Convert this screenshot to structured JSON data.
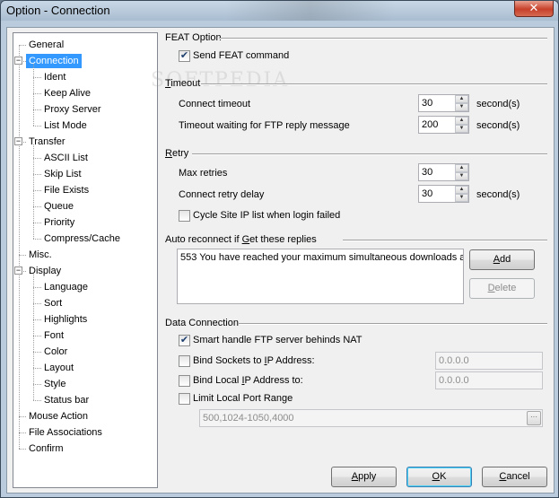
{
  "window": {
    "title": "Option - Connection",
    "close_label": "✕",
    "watermark": "SOFTPEDIA"
  },
  "tree": {
    "items": [
      {
        "label": "General",
        "level": 0
      },
      {
        "label": "Connection",
        "level": 0,
        "selected": true,
        "expander": "−"
      },
      {
        "label": "Ident",
        "level": 1
      },
      {
        "label": "Keep Alive",
        "level": 1
      },
      {
        "label": "Proxy Server",
        "level": 1
      },
      {
        "label": "List Mode",
        "level": 1
      },
      {
        "label": "Transfer",
        "level": 0,
        "expander": "−"
      },
      {
        "label": "ASCII List",
        "level": 1
      },
      {
        "label": "Skip List",
        "level": 1
      },
      {
        "label": "File Exists",
        "level": 1
      },
      {
        "label": "Queue",
        "level": 1
      },
      {
        "label": "Priority",
        "level": 1
      },
      {
        "label": "Compress/Cache",
        "level": 1
      },
      {
        "label": "Misc.",
        "level": 0
      },
      {
        "label": "Display",
        "level": 0,
        "expander": "−"
      },
      {
        "label": "Language",
        "level": 1
      },
      {
        "label": "Sort",
        "level": 1
      },
      {
        "label": "Highlights",
        "level": 1
      },
      {
        "label": "Font",
        "level": 1
      },
      {
        "label": "Color",
        "level": 1
      },
      {
        "label": "Layout",
        "level": 1
      },
      {
        "label": "Style",
        "level": 1
      },
      {
        "label": "Status bar",
        "level": 1
      },
      {
        "label": "Mouse Action",
        "level": 0
      },
      {
        "label": "File Associations",
        "level": 0
      },
      {
        "label": "Confirm",
        "level": 0
      }
    ]
  },
  "feat": {
    "title": "FEAT Option",
    "send_feat_label": "Send FEAT command",
    "send_feat_checked": true
  },
  "timeout": {
    "title_prefix": "",
    "title_underline": "T",
    "title_rest": "imeout",
    "connect_label": "Connect timeout",
    "connect_value": "30",
    "connect_unit": "second(s)",
    "reply_label": "Timeout waiting for FTP reply message",
    "reply_value": "200",
    "reply_unit": "second(s)"
  },
  "retry": {
    "title_underline": "R",
    "title_rest": "etry",
    "max_label": "Max retries",
    "max_value": "30",
    "delay_label": "Connect retry delay",
    "delay_value": "30",
    "delay_unit": "second(s)",
    "cycle_label": "Cycle Site IP list when login failed",
    "cycle_checked": false
  },
  "reconnect": {
    "title_prefix": "Auto reconnect if ",
    "title_underline": "G",
    "title_rest": "et these replies",
    "text": "553 You have reached your maximum simultaneous downloads a",
    "add_underline": "A",
    "add_rest": "dd",
    "delete_underline": "D",
    "delete_rest": "elete"
  },
  "data_connection": {
    "title": "Data Connection",
    "smart_label": "Smart handle FTP server behinds NAT",
    "smart_checked": true,
    "bind_sockets_prefix": "Bind Sockets to ",
    "bind_sockets_underline": "I",
    "bind_sockets_rest": "P Address:",
    "bind_sockets_value": "0.0.0.0",
    "bind_local_prefix": "Bind Local ",
    "bind_local_underline": "I",
    "bind_local_rest": "P Address to:",
    "bind_local_value": "0.0.0.0",
    "limit_label": "Limit Local Port Range",
    "port_range_value": "500,1024-1050,4000",
    "ellipsis_label": "···"
  },
  "footer": {
    "apply_underline": "A",
    "apply_rest": "pply",
    "ok_underline": "O",
    "ok_rest": "K",
    "cancel_underline": "C",
    "cancel_rest": "ancel"
  }
}
